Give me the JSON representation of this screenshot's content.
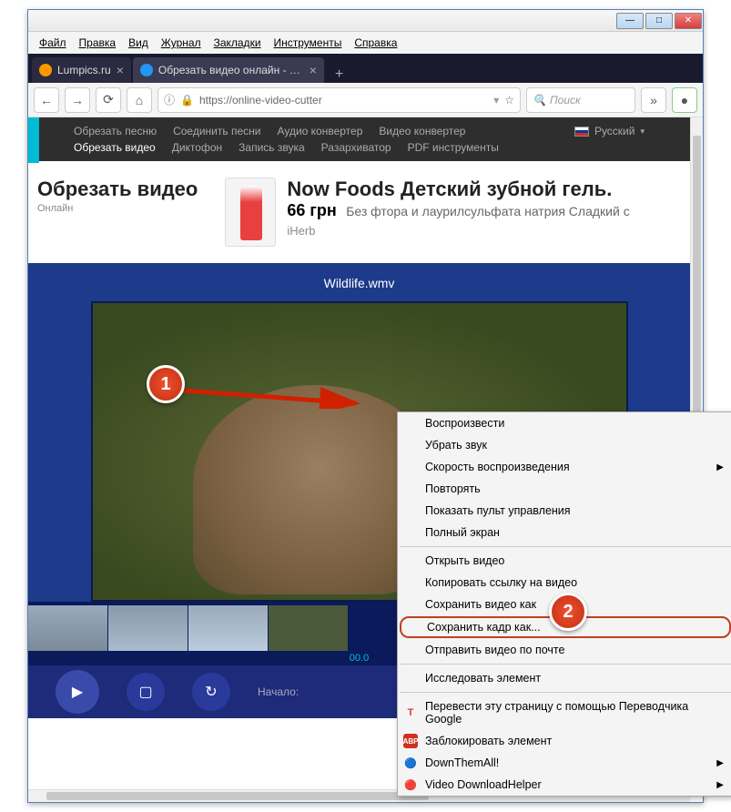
{
  "menubar": [
    "Файл",
    "Правка",
    "Вид",
    "Журнал",
    "Закладки",
    "Инструменты",
    "Справка"
  ],
  "tabs": [
    {
      "label": "Lumpics.ru",
      "favicon": "#ff9800"
    },
    {
      "label": "Обрезать видео онлайн - обр",
      "favicon": "#2196f3",
      "active": true
    }
  ],
  "url": "https://online-video-cutter",
  "search_placeholder": "Поиск",
  "sitenav_row1": [
    "Обрезать песню",
    "Соединить песни",
    "Аудио конвертер",
    "Видео конвертер"
  ],
  "sitenav_row2": [
    "Обрезать видео",
    "Диктофон",
    "Запись звука",
    "Разархиватор",
    "PDF инструменты"
  ],
  "language": "Русский",
  "page_title": "Обрезать видео",
  "page_sub": "Онлайн",
  "ad": {
    "title": "Now Foods Детский зубной гель.",
    "price": "66 грн",
    "desc": "Без фтора и лаурилсульфата натрия Сладкий с",
    "brand": "iHerb"
  },
  "filename": "Wildlife.wmv",
  "timeline_start": "00.0",
  "controls_start_label": "Начало:",
  "markers": {
    "one": "1",
    "two": "2"
  },
  "context_menu": {
    "play": "Воспроизвести",
    "mute": "Убрать звук",
    "speed": "Скорость воспроизведения",
    "loop": "Повторять",
    "show_controls": "Показать пульт управления",
    "fullscreen": "Полный экран",
    "open_video": "Открыть видео",
    "copy_link": "Копировать ссылку на видео",
    "save_video": "Сохранить видео как",
    "save_frame": "Сохранить кадр как...",
    "send_email": "Отправить видео по почте",
    "inspect": "Исследовать элемент",
    "translate": "Перевести эту страницу с помощью Переводчика Google",
    "adblock": "Заблокировать элемент",
    "downthemall": "DownThemAll!",
    "videohelper": "Video DownloadHelper"
  }
}
